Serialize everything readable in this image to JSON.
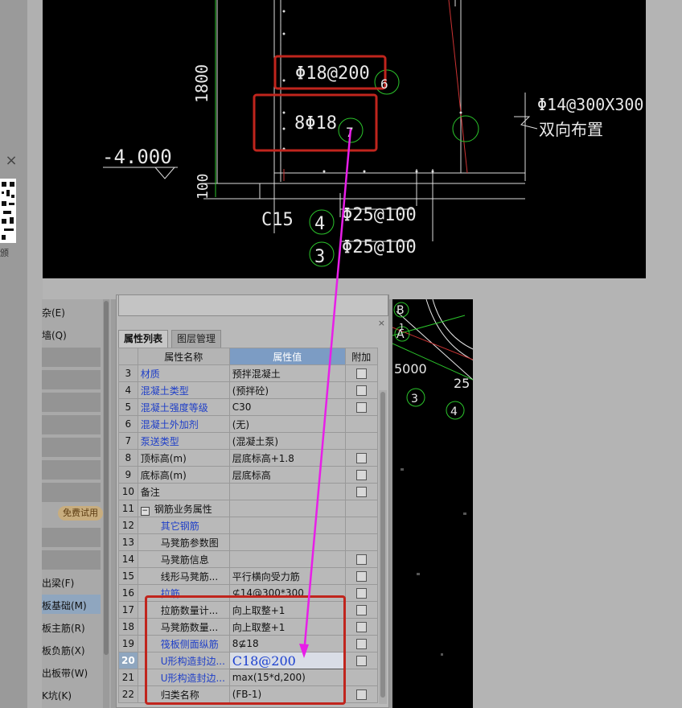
{
  "window": {
    "close_glyph": "×"
  },
  "qr": {
    "caption": "颁"
  },
  "cad_top": {
    "dim_1800": "1800",
    "dim_100": "100",
    "level": "-4.000",
    "rebar_a": "Φ18@200",
    "rebar_b": "8Φ18",
    "rebar_c": "Φ14@300X300",
    "note": "双向布置",
    "conc": "C15",
    "rebar_d": "Φ25@100",
    "rebar_e": "Φ25@100",
    "bubble_4": "4",
    "bubble_3": "3",
    "bubble_6": "6",
    "bubble_7": "7"
  },
  "cad_right": {
    "b": "B",
    "a": "A",
    "one": "1",
    "dim": "5000",
    "dim2": "25",
    "n3": "3",
    "n4": "4"
  },
  "nav": {
    "items": [
      {
        "label": "杂(E)"
      },
      {
        "label": "墙(Q)"
      },
      {
        "label": "出梁(F)"
      },
      {
        "label": "板基础(M)"
      },
      {
        "label": "板主筋(R)"
      },
      {
        "label": "板负筋(X)"
      },
      {
        "label": "出板带(W)"
      },
      {
        "label": "K坑(K)"
      }
    ],
    "trial": "免费试用"
  },
  "panel": {
    "close": "×",
    "tabs": [
      "属性列表",
      "图层管理"
    ],
    "headers": [
      "属性名称",
      "属性值",
      "附加"
    ],
    "rows": [
      {
        "n": "3",
        "name": "材质",
        "value": "预拌混凝土",
        "blue": true,
        "chk": true,
        "indent": 0
      },
      {
        "n": "4",
        "name": "混凝土类型",
        "value": "(预拌砼)",
        "blue": true,
        "chk": true,
        "indent": 0
      },
      {
        "n": "5",
        "name": "混凝土强度等级",
        "value": "C30",
        "blue": true,
        "chk": true,
        "indent": 0
      },
      {
        "n": "6",
        "name": "混凝土外加剂",
        "value": "(无)",
        "blue": true,
        "chk": false,
        "indent": 0
      },
      {
        "n": "7",
        "name": "泵送类型",
        "value": "(混凝土泵)",
        "blue": true,
        "chk": false,
        "indent": 0
      },
      {
        "n": "8",
        "name": "顶标高(m)",
        "value": "层底标高+1.8",
        "blue": false,
        "chk": true,
        "indent": 0
      },
      {
        "n": "9",
        "name": "底标高(m)",
        "value": "层底标高",
        "blue": false,
        "chk": true,
        "indent": 0
      },
      {
        "n": "10",
        "name": "备注",
        "value": "",
        "blue": false,
        "chk": true,
        "indent": 0
      },
      {
        "n": "11",
        "name": "钢筋业务属性",
        "value": "",
        "blue": false,
        "chk": false,
        "indent": 0,
        "group": true
      },
      {
        "n": "12",
        "name": "其它钢筋",
        "value": "",
        "blue": true,
        "chk": false,
        "indent": 2
      },
      {
        "n": "13",
        "name": "马凳筋参数图",
        "value": "",
        "blue": false,
        "chk": false,
        "indent": 2
      },
      {
        "n": "14",
        "name": "马凳筋信息",
        "value": "",
        "blue": false,
        "chk": true,
        "indent": 2
      },
      {
        "n": "15",
        "name": "线形马凳筋...",
        "value": "平行横向受力筋",
        "blue": false,
        "chk": true,
        "indent": 2
      },
      {
        "n": "16",
        "name": "拉筋",
        "value": "⊈14@300*300",
        "blue": true,
        "chk": true,
        "indent": 2
      },
      {
        "n": "17",
        "name": "拉筋数量计...",
        "value": "向上取整+1",
        "blue": false,
        "chk": true,
        "indent": 2
      },
      {
        "n": "18",
        "name": "马凳筋数量...",
        "value": "向上取整+1",
        "blue": false,
        "chk": true,
        "indent": 2
      },
      {
        "n": "19",
        "name": "筏板侧面纵筋",
        "value": "8⊈18",
        "blue": true,
        "chk": true,
        "indent": 2
      },
      {
        "n": "20",
        "name": "U形构造封边...",
        "value": "C18@200",
        "blue": true,
        "chk": true,
        "indent": 2,
        "editing": true
      },
      {
        "n": "21",
        "name": "U形构造封边...",
        "value": "max(15*d,200)",
        "blue": true,
        "chk": false,
        "indent": 2
      },
      {
        "n": "22",
        "name": "归类名称",
        "value": "(FB-1)",
        "blue": false,
        "chk": true,
        "indent": 2
      }
    ],
    "group_toggle": "−"
  },
  "colors": {
    "accent": "#7c9cc4",
    "highlight_red": "#c0251d",
    "arrow": "#e81ee8",
    "cad_bg": "#000000"
  }
}
